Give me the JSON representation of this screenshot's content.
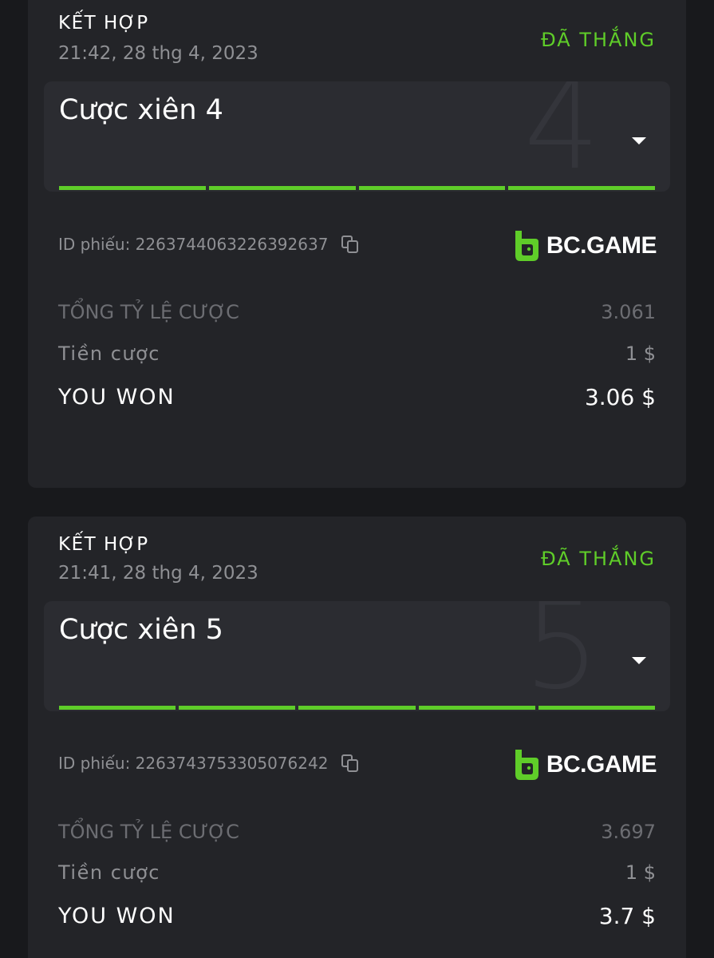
{
  "bets": [
    {
      "type": "KẾT HỢP",
      "time": "21:42, 28 thg 4, 2023",
      "status": "ĐÃ THẮNG",
      "parlay_label": "Cược xiên 4",
      "parlay_count": "4",
      "legs_won": 4,
      "ticket_id": "ID phiếu: 2263744063226392637",
      "brand": "BC.GAME",
      "total_odds_label": "TỔNG TỶ LỆ CƯỢC",
      "total_odds": "3.061",
      "stake_label": "Tiền cược",
      "stake": "1 $",
      "won_label": "YOU WON",
      "won": "3.06 $"
    },
    {
      "type": "KẾT HỢP",
      "time": "21:41, 28 thg 4, 2023",
      "status": "ĐÃ THẮNG",
      "parlay_label": "Cược xiên 5",
      "parlay_count": "5",
      "legs_won": 5,
      "ticket_id": "ID phiếu: 2263743753305076242",
      "brand": "BC.GAME",
      "total_odds_label": "TỔNG TỶ LỆ CƯỢC",
      "total_odds": "3.697",
      "stake_label": "Tiền cược",
      "stake": "1 $",
      "won_label": "YOU WON",
      "won": "3.7 $"
    }
  ],
  "colors": {
    "accent_green": "#5fcd29",
    "card_bg": "#232428",
    "page_bg": "#18191c"
  },
  "icons": {
    "copy": "copy-icon",
    "expand": "chevron-down-icon",
    "brand": "bc-game-logo-icon"
  }
}
